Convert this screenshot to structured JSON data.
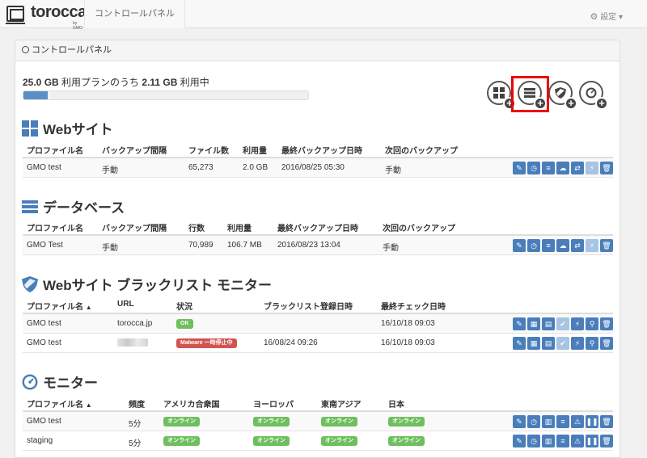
{
  "navbar": {
    "logo_text": "torocca!",
    "logo_sub": "by GMO",
    "control_panel_link": "コントロールパネル",
    "settings_label": "設定"
  },
  "panel": {
    "title": "コントロールパネル"
  },
  "usage": {
    "plan": "25.0 GB",
    "plan_suffix": "利用プランのうち",
    "used": "2.11 GB",
    "used_suffix": "利用中",
    "fraction": 0.084
  },
  "add_buttons": [
    {
      "icon": "website-add-icon"
    },
    {
      "icon": "database-add-icon",
      "highlighted": true
    },
    {
      "icon": "blacklist-monitor-add-icon"
    },
    {
      "icon": "monitor-add-icon"
    }
  ],
  "website": {
    "title": "Webサイト",
    "headers": [
      "プロファイル名",
      "バックアップ間隔",
      "ファイル数",
      "利用量",
      "最終バックアップ日時",
      "次回のバックアップ"
    ],
    "rows": [
      [
        "GMO test",
        "手動",
        "65,273",
        "2.0 GB",
        "2016/08/25 05:30",
        "手動"
      ]
    ]
  },
  "database": {
    "title": "データベース",
    "headers": [
      "プロファイル名",
      "バックアップ間隔",
      "行数",
      "利用量",
      "最終バックアップ日時",
      "次回のバックアップ"
    ],
    "rows": [
      [
        "GMO Test",
        "手動",
        "70,989",
        "106.7 MB",
        "2016/08/23 13:04",
        "手動"
      ]
    ]
  },
  "blacklist": {
    "title": "Webサイト ブラックリスト モニター",
    "headers": [
      "プロファイル名",
      "URL",
      "状況",
      "ブラックリスト登録日時",
      "最終チェック日時"
    ],
    "sort_arrow": "▲",
    "rows": [
      {
        "name": "GMO test",
        "url": "torocca.jp",
        "status": "OK",
        "status_type": "ok",
        "listed": "",
        "checked": "16/10/18 09:03"
      },
      {
        "name": "GMO test",
        "url": "",
        "status": "Malware 一時停止中",
        "status_type": "danger",
        "listed": "16/08/24 09:26",
        "checked": "16/10/18 09:03"
      }
    ]
  },
  "monitor": {
    "title": "モニター",
    "headers": [
      "プロファイル名",
      "頻度",
      "アメリカ合衆国",
      "ヨーロッパ",
      "東南アジア",
      "日本"
    ],
    "sort_arrow": "▲",
    "online": "オンライン",
    "rows": [
      {
        "name": "GMO test",
        "freq": "5分"
      },
      {
        "name": "staging",
        "freq": "5分"
      }
    ]
  }
}
